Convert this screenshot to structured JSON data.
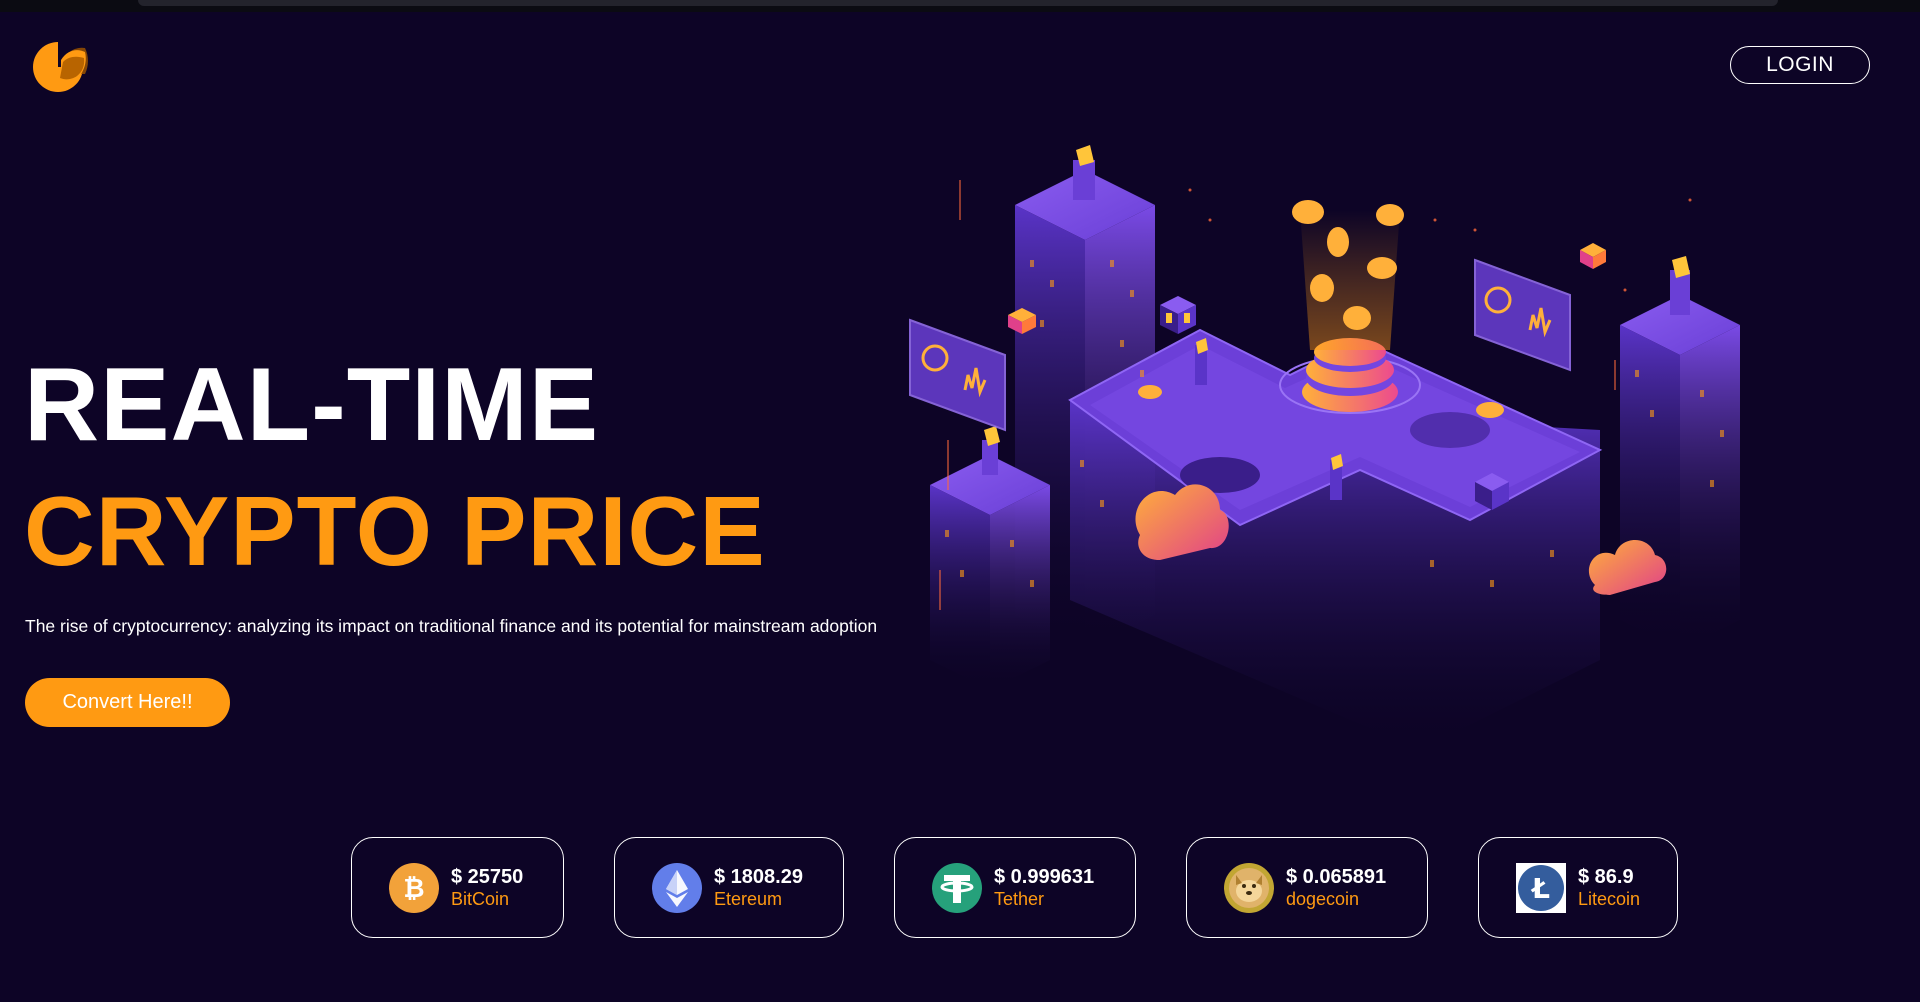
{
  "header": {
    "login_label": "LOGIN"
  },
  "hero": {
    "title_line1": "REAL-TIME",
    "title_line2": "CRYPTO PRICE",
    "subtitle": "The rise of cryptocurrency: analyzing its impact on traditional finance and its potential for mainstream adoption",
    "cta_label": "Convert Here!!"
  },
  "coins": [
    {
      "price": "$ 25750",
      "name": "BitCoin",
      "icon": "bitcoin-icon"
    },
    {
      "price": "$ 1808.29",
      "name": "Etereum",
      "icon": "ethereum-icon"
    },
    {
      "price": "$ 0.999631",
      "name": "Tether",
      "icon": "tether-icon"
    },
    {
      "price": "$ 0.065891",
      "name": "dogecoin",
      "icon": "dogecoin-icon"
    },
    {
      "price": "$ 86.9",
      "name": "Litecoin",
      "icon": "litecoin-icon"
    }
  ],
  "colors": {
    "background": "#0d0426",
    "accent": "#ff9a12",
    "text": "#ffffff",
    "illustration_purple": "#6a3fd6"
  }
}
